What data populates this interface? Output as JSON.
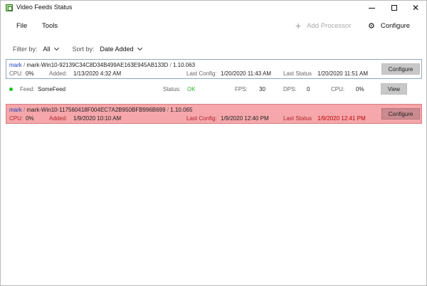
{
  "window": {
    "title": "Video Feeds Status",
    "app_icon": "video-feeds-icon",
    "controls": {
      "minimize": "minimize-icon",
      "maximize": "maximize-icon",
      "close": "✕"
    }
  },
  "menu": {
    "file": "File",
    "tools": "Tools",
    "add_processor": "Add Processor",
    "add_processor_icon": "+",
    "configure": "Configure",
    "configure_icon": "⚙"
  },
  "filters": {
    "filter_label": "Filter by:",
    "filter_value": "All",
    "sort_label": "Sort by:",
    "sort_value": "Date Added"
  },
  "processors": [
    {
      "user": "mark",
      "separator": "/",
      "machine": "mark-Win10-92139C34C8D34B499AE163E945AB133D",
      "version_separator": "/",
      "version": "1.10.063",
      "cpu_label": "CPU:",
      "cpu_value": "0%",
      "added_label": "Added:",
      "added_value": "1/13/2020 4:32 AM",
      "last_config_label": "Last Config:",
      "last_config_value": "1/20/2020 11:43 AM",
      "last_status_label": "Last Status",
      "last_status_value": "1/20/2020 11:51 AM",
      "button": "Configure",
      "status_color": "#ffffff"
    },
    {
      "user": "mark",
      "separator": "/",
      "machine": "mark-Win10-117560418F004EC7A2B950BFB996B699",
      "version_separator": "/",
      "version": "1.10.065",
      "cpu_label": "CPU:",
      "cpu_value": "0%",
      "added_label": "Added:",
      "added_value": "1/9/2020 10:10 AM",
      "last_config_label": "Last Config:",
      "last_config_value": "1/9/2020 12:40 PM",
      "last_status_label": "Last Status",
      "last_status_value": "1/9/2020 12:41 PM",
      "button": "Configure",
      "status_color": "#f5a7ab"
    }
  ],
  "feed": {
    "feed_label": "Feed:",
    "feed_name": "SomeFeed",
    "status_label": "Status:",
    "status_value": "OK",
    "fps_label": "FPS:",
    "fps_value": "30",
    "dps_label": "DPS:",
    "dps_value": "0",
    "cpu_label": "CPU:",
    "cpu_value": "0%",
    "button": "View",
    "status_dot_color": "#17c21e"
  }
}
